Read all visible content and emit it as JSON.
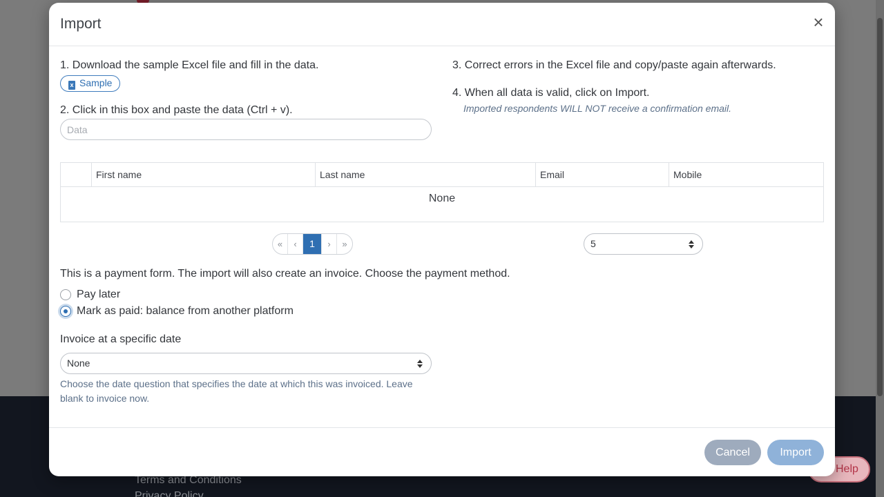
{
  "background": {
    "footer_links": [
      "Terms and Conditions",
      "Privacy Policy"
    ],
    "help_label": "Help"
  },
  "modal": {
    "title": "Import",
    "close_glyph": "×",
    "step1": "1. Download the sample Excel file and fill in the data.",
    "sample_label": "Sample",
    "step2": "2. Click in this box and paste the data (Ctrl + v).",
    "data_placeholder": "Data",
    "step3": "3. Correct errors in the Excel file and copy/paste again afterwards.",
    "step4": "4. When all data is valid, click on Import.",
    "step4_note": "Imported respondents WILL NOT receive a confirmation email.",
    "table": {
      "columns": [
        "First name",
        "Last name",
        "Email",
        "Mobile"
      ],
      "empty_text": "None"
    },
    "pagination": {
      "first": "«",
      "prev": "‹",
      "current": "1",
      "next": "›",
      "last": "»"
    },
    "page_size": "5",
    "payment_text": "This is a payment form. The import will also create an invoice. Choose the payment method.",
    "payment_options": [
      {
        "label": "Pay later",
        "checked": false
      },
      {
        "label": "Mark as paid: balance from another platform",
        "checked": true
      }
    ],
    "invoice_label": "Invoice at a specific date",
    "invoice_value": "None",
    "invoice_help": "Choose the date question that specifies the date at which this was invoiced. Leave blank to invoice now.",
    "cancel_label": "Cancel",
    "import_label": "Import"
  },
  "colors": {
    "primary": "#2f6fb2",
    "overlay": "#7b7b7b",
    "cancel": "#9eabbd",
    "import": "#8fb2d9"
  }
}
